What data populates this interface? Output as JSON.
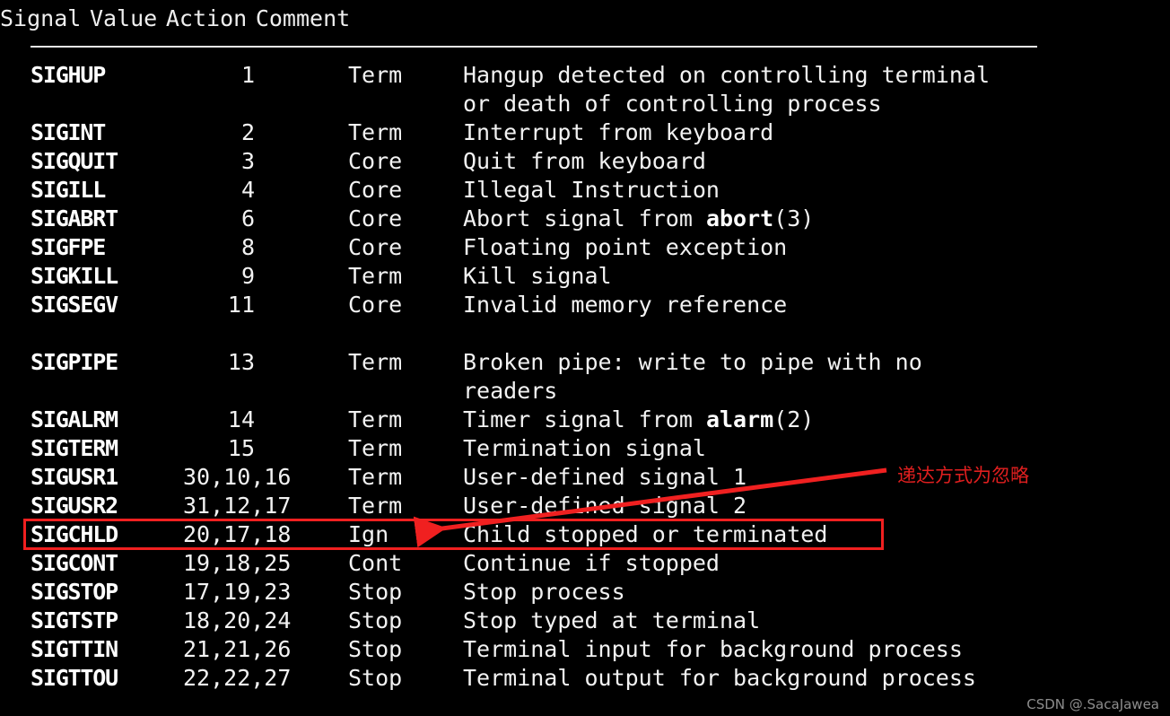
{
  "page": {
    "background_color": "#000000",
    "text_color": "#f2f2f2",
    "accent_color": "#f02020"
  },
  "table": {
    "headers": {
      "signal": "Signal",
      "value": "Value",
      "action": "Action",
      "comment": "Comment"
    },
    "rows": [
      {
        "signal": "SIGHUP",
        "value": "1",
        "action": "Term",
        "comment": "Hangup detected on controlling terminal",
        "comment_cont": "or death of controlling process"
      },
      {
        "signal": "SIGINT",
        "value": "2",
        "action": "Term",
        "comment": "Interrupt from keyboard"
      },
      {
        "signal": "SIGQUIT",
        "value": "3",
        "action": "Core",
        "comment": "Quit from keyboard"
      },
      {
        "signal": "SIGILL",
        "value": "4",
        "action": "Core",
        "comment": "Illegal Instruction"
      },
      {
        "signal": "SIGABRT",
        "value": "6",
        "action": "Core",
        "comment": "Abort signal from ",
        "comment_bold": "abort",
        "comment_tail": "(3)"
      },
      {
        "signal": "SIGFPE",
        "value": "8",
        "action": "Core",
        "comment": "Floating point exception"
      },
      {
        "signal": "SIGKILL",
        "value": "9",
        "action": "Term",
        "comment": "Kill signal"
      },
      {
        "signal": "SIGSEGV",
        "value": "11",
        "action": "Core",
        "comment": "Invalid memory reference"
      },
      {
        "signal": "",
        "value": "",
        "action": "",
        "comment": ""
      },
      {
        "signal": "SIGPIPE",
        "value": "13",
        "action": "Term",
        "comment": "Broken pipe: write to pipe with no",
        "comment_cont": "readers"
      },
      {
        "signal": "SIGALRM",
        "value": "14",
        "action": "Term",
        "comment": "Timer signal from ",
        "comment_bold": "alarm",
        "comment_tail": "(2)"
      },
      {
        "signal": "SIGTERM",
        "value": "15",
        "action": "Term",
        "comment": "Termination signal"
      },
      {
        "signal": "SIGUSR1",
        "value": "30,10,16",
        "action": "Term",
        "comment": "User-defined signal 1"
      },
      {
        "signal": "SIGUSR2",
        "value": "31,12,17",
        "action": "Term",
        "comment": "User-defined signal 2"
      },
      {
        "signal": "SIGCHLD",
        "value": "20,17,18",
        "action": "Ign",
        "comment": "Child stopped or terminated",
        "highlighted": true
      },
      {
        "signal": "SIGCONT",
        "value": "19,18,25",
        "action": "Cont",
        "comment": "Continue if stopped"
      },
      {
        "signal": "SIGSTOP",
        "value": "17,19,23",
        "action": "Stop",
        "comment": "Stop process"
      },
      {
        "signal": "SIGTSTP",
        "value": "18,20,24",
        "action": "Stop",
        "comment": "Stop typed at terminal"
      },
      {
        "signal": "SIGTTIN",
        "value": "21,21,26",
        "action": "Stop",
        "comment": "Terminal input for background process"
      },
      {
        "signal": "SIGTTOU",
        "value": "22,22,27",
        "action": "Stop",
        "comment": "Terminal output for background process"
      }
    ]
  },
  "annotation": {
    "label": "递达方式为忽略",
    "color": "#e01f1f",
    "highlight_target": "SIGCHLD"
  },
  "watermark": {
    "text": "CSDN @.SacaJawea"
  }
}
